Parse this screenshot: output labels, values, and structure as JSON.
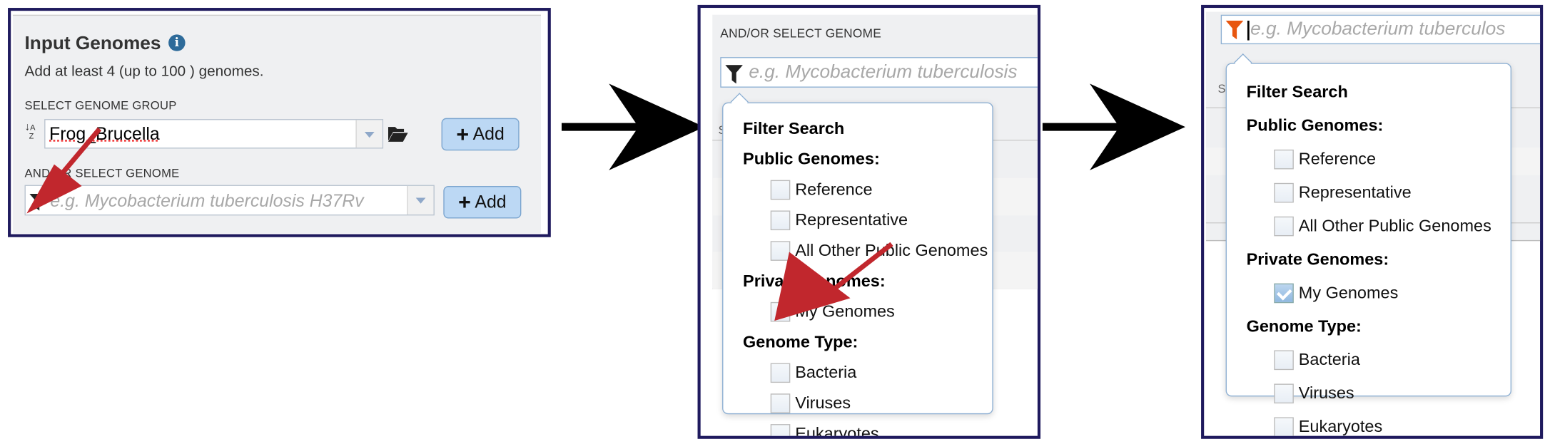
{
  "step1": {
    "title": "Input Genomes",
    "subtitle": "Add at least 4 (up to 100 ) genomes.",
    "group_label": "SELECT GENOME GROUP",
    "group_value": "Frog_Brucella",
    "add_label": "Add",
    "genome_label": "AND/OR SELECT GENOME",
    "genome_placeholder": "e.g. Mycobacterium tuberculosis H37Rv",
    "add2_label": "Add"
  },
  "step2": {
    "genome_label": "AND/OR SELECT GENOME",
    "genome_placeholder": "e.g. Mycobacterium tuberculosis",
    "behind_label": "S"
  },
  "step3": {
    "genome_placeholder": "e.g. Mycobacterium tuberculos",
    "behind_label": "S"
  },
  "filter_popup": {
    "title": "Filter Search",
    "public_heading": "Public Genomes:",
    "public_items": [
      "Reference",
      "Representative",
      "All Other Public Genomes"
    ],
    "private_heading": "Private Genomes:",
    "private_items": [
      "My Genomes"
    ],
    "type_heading": "Genome Type:",
    "type_items": [
      "Bacteria",
      "Viruses",
      "Eukaryotes"
    ]
  },
  "states": {
    "step2_my_genomes_checked": false,
    "step3_my_genomes_checked": true
  },
  "colors": {
    "frame_border": "#1f1a5e",
    "panel_bg": "#eff0f2",
    "add_button": "#bcd8f4",
    "info_icon": "#2e6b9a",
    "annotation_arrow": "#c1272d",
    "active_filter_icon": "#e8560f"
  }
}
